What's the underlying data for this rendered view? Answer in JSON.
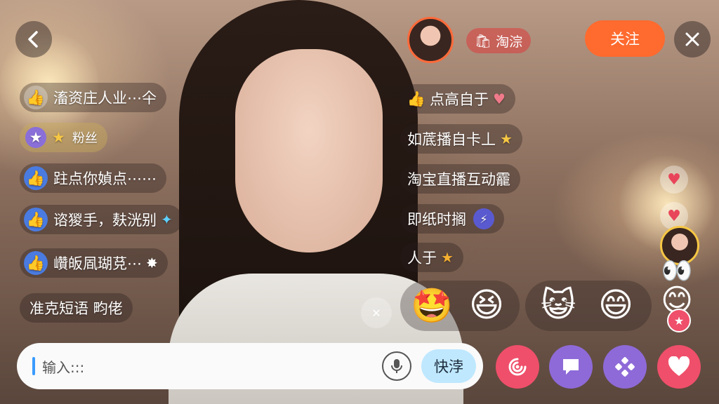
{
  "top": {
    "back_icon": "chevron-left-icon",
    "badge_label": "淘淙",
    "follow_label": "关注",
    "close_icon": "close-icon"
  },
  "left_comments": [
    {
      "text": "滀资庄人业⋯仐",
      "icon": "thumbs-up-icon"
    },
    {
      "text": "粉丝",
      "icon": "star-badge-icon"
    },
    {
      "text": "跓点你媜点⋯⋯",
      "icon": "thumbs-up-icon"
    },
    {
      "text": "谘猣手，麸洸别",
      "icon": "thumbs-up-icon"
    },
    {
      "text": "巑皈凮瑚莌⋯",
      "icon": "thumbs-up-icon"
    },
    {
      "text": "准克短语 畇佬",
      "icon": ""
    }
  ],
  "right_comments": [
    {
      "text": "点高自于",
      "icon": "thumbs-up-icon"
    },
    {
      "text": "如菧播自卡丄",
      "icon": ""
    },
    {
      "text": "淘宝直播互动靇",
      "icon": ""
    },
    {
      "text": "即纸时搁",
      "icon": "bolt-icon"
    },
    {
      "text": "人于",
      "icon": "star-icon"
    }
  ],
  "emoji_row": [
    "🤩",
    "😆",
    "😺",
    "😄"
  ],
  "input": {
    "placeholder": "输入:::",
    "quick_label": "快浡"
  },
  "colors": {
    "follow": "#ff6a2e",
    "action_red": "#ef4f6a",
    "action_purple": "#8e6ad8",
    "quick_bg": "#bfe8ff"
  }
}
